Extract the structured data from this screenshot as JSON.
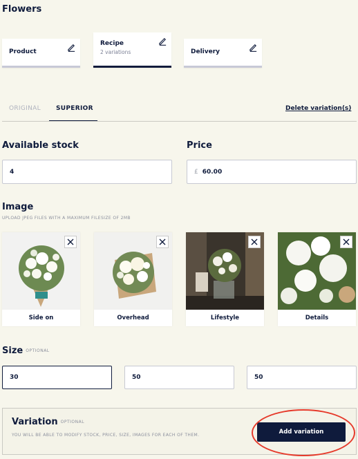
{
  "page": {
    "title": "Flowers"
  },
  "steps": [
    {
      "label": "Product",
      "sublabel": ""
    },
    {
      "label": "Recipe",
      "sublabel": "2 variations"
    },
    {
      "label": "Delivery",
      "sublabel": ""
    }
  ],
  "tabs": {
    "original": "ORIGINAL",
    "superior": "SUPERIOR",
    "delete_link": "Delete variation(s)"
  },
  "stock": {
    "label": "Available stock",
    "value": "4"
  },
  "price": {
    "label": "Price",
    "currency": "£",
    "value": "60.00"
  },
  "image": {
    "label": "Image",
    "help": "UPLOAD JPEG FILES WITH A MAXIMUM FILESIZE OF 2MB",
    "items": [
      {
        "caption": "Side on"
      },
      {
        "caption": "Overhead"
      },
      {
        "caption": "Lifestyle"
      },
      {
        "caption": "Details"
      }
    ]
  },
  "size": {
    "label": "Size",
    "optional": "OPTIONAL",
    "values": [
      "30",
      "50",
      "50"
    ]
  },
  "variation": {
    "label": "Variation",
    "optional": "OPTIONAL",
    "help": "YOU WILL BE ABLE TO MODIFY STOCK, PRICE, SIZE, IMAGES FOR EACH OF THEM.",
    "button": "Add variation"
  },
  "colors": {
    "navy": "#0f1b3c",
    "highlight": "#e63a2b",
    "background": "#f7f6ec"
  },
  "icons": {
    "edit": "pencil-icon",
    "remove": "close-icon"
  }
}
